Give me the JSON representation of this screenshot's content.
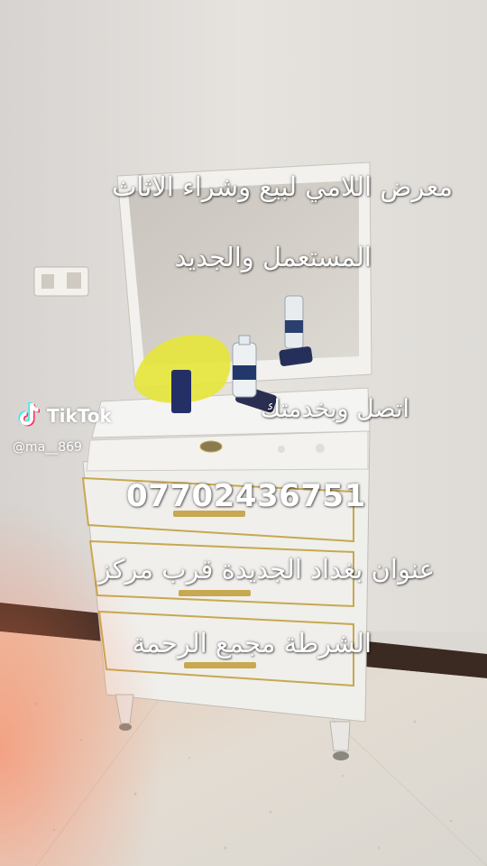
{
  "overlay": {
    "line1": "معرض اللامي لبيع وشراء الاثاث",
    "line2": "المستعمل والجديد",
    "line3": "اتصل  وبخدمتك",
    "phone": "07702436751",
    "line5": "عنوان بغداد الجديدة قرب مركز",
    "line6": "الشرطة مجمع الرحمة"
  },
  "watermark": {
    "brand": "TikTok",
    "handle": "@ma__869",
    "icon": "tiktok-logo-icon"
  },
  "colors": {
    "text": "#ffffff",
    "wall": "#e2dfdb",
    "furniture": "#efefec",
    "gold_trim": "#c8a850",
    "bag": "#e8e830"
  }
}
